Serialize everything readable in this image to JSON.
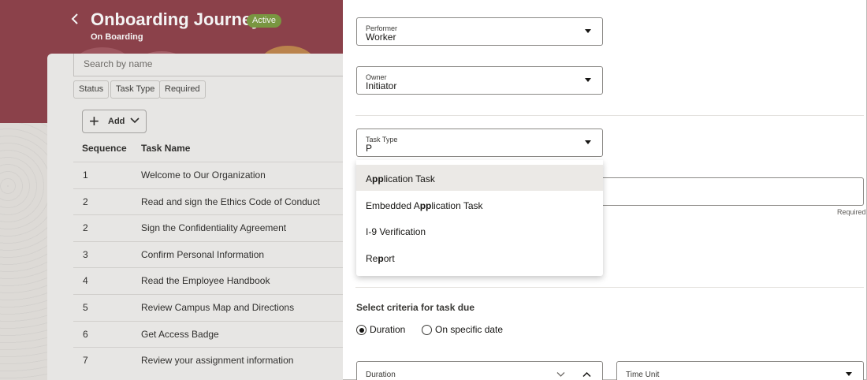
{
  "header": {
    "back_icon": "chevron-left-icon",
    "title": "Onboarding Journey",
    "status": "Active",
    "subtitle": "On Boarding"
  },
  "task_list": {
    "search_placeholder": "Search by name",
    "filters": [
      "Status",
      "Task Type",
      "Required"
    ],
    "add_label": "Add",
    "columns": {
      "sequence": "Sequence",
      "task_name": "Task Name"
    },
    "rows": [
      {
        "seq": "1",
        "name": "Welcome to Our Organization"
      },
      {
        "seq": "2",
        "name": "Read and sign the Ethics Code of Conduct"
      },
      {
        "seq": "2",
        "name": "Sign the Confidentiality Agreement"
      },
      {
        "seq": "3",
        "name": "Confirm Personal Information"
      },
      {
        "seq": "4",
        "name": "Read the Employee Handbook"
      },
      {
        "seq": "5",
        "name": "Review Campus Map and Directions"
      },
      {
        "seq": "6",
        "name": "Get Access Badge"
      },
      {
        "seq": "7",
        "name": "Review your assignment information"
      }
    ]
  },
  "drawer": {
    "performer": {
      "label": "Performer",
      "value": "Worker"
    },
    "owner": {
      "label": "Owner",
      "value": "Initiator"
    },
    "task_type": {
      "label": "Task Type",
      "value": "P"
    },
    "task_type_options": [
      {
        "pre": "A",
        "match": "pp",
        "post": "lication Task",
        "highlighted": true
      },
      {
        "pre": "Embedded A",
        "match": "pp",
        "post": "lication Task",
        "highlighted": false
      },
      {
        "pre": "I-9 Verification",
        "match": "",
        "post": "",
        "highlighted": false
      },
      {
        "pre": "Re",
        "match": "p",
        "post": "ort",
        "highlighted": false
      }
    ],
    "required_note": "Required",
    "criteria_title": "Select criteria for task due",
    "criteria_options": [
      {
        "label": "Duration",
        "selected": true
      },
      {
        "label": "On specific date",
        "selected": false
      }
    ],
    "duration": {
      "label": "Duration"
    },
    "time_unit": {
      "label": "Time Unit"
    }
  },
  "colors": {
    "banner": "#8e3d47",
    "badge": "#7a9a3d",
    "highlight": "#ebe9e6"
  }
}
